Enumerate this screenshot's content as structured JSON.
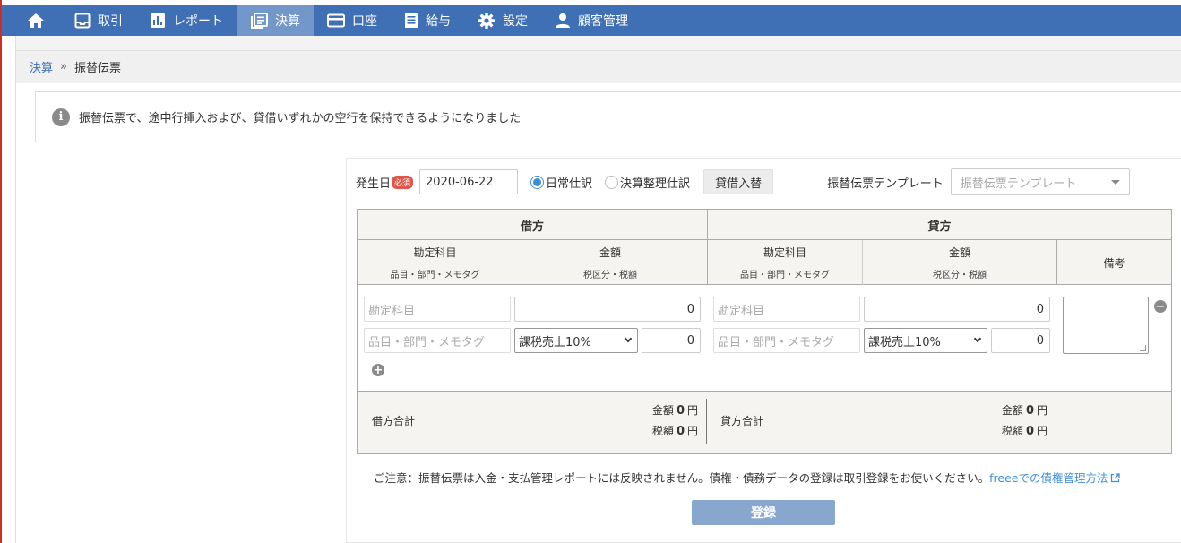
{
  "nav": {
    "items": [
      {
        "label": "取引"
      },
      {
        "label": "レポート"
      },
      {
        "label": "決算"
      },
      {
        "label": "口座"
      },
      {
        "label": "給与"
      },
      {
        "label": "設定"
      },
      {
        "label": "顧客管理"
      }
    ]
  },
  "breadcrumb": {
    "parent": "決算",
    "separator": "»",
    "current": "振替伝票"
  },
  "notice": {
    "text": "振替伝票で、途中行挿入および、貸借いずれかの空行を保持できるようになりました"
  },
  "form": {
    "date_label": "発生日",
    "required_badge": "必須",
    "date_value": "2020-06-22",
    "radio_normal": "日常仕訳",
    "radio_closing": "決算整理仕訳",
    "swap_button": "貸借入替",
    "template_label": "振替伝票テンプレート",
    "template_placeholder": "振替伝票テンプレート"
  },
  "table": {
    "debit_header": "借方",
    "credit_header": "貸方",
    "account_header": "勘定科目",
    "account_sub": "品目・部門・メモタグ",
    "amount_header": "金額",
    "amount_sub": "税区分・税額",
    "memo_header": "備考",
    "row": {
      "debit_account_placeholder": "勘定科目",
      "debit_amount": "0",
      "debit_tags_placeholder": "品目・部門・メモタグ",
      "debit_tax_category": "課税売上10%",
      "debit_tax_amount": "0",
      "credit_account_placeholder": "勘定科目",
      "credit_amount": "0",
      "credit_tags_placeholder": "品目・部門・メモタグ",
      "credit_tax_category": "課税売上10%",
      "credit_tax_amount": "0"
    },
    "totals": {
      "debit_label": "借方合計",
      "credit_label": "貸方合計",
      "amount_label": "金額",
      "tax_label": "税額",
      "debit_amount": "0",
      "debit_tax": "0",
      "credit_amount": "0",
      "credit_tax": "0",
      "currency": "円"
    }
  },
  "caution": {
    "text": "ご注意：振替伝票は入金・支払管理レポートには反映されません。債権・債務データの登録は取引登録をお使いください。",
    "link": "freeeでの債権管理方法"
  },
  "submit_label": "登録"
}
